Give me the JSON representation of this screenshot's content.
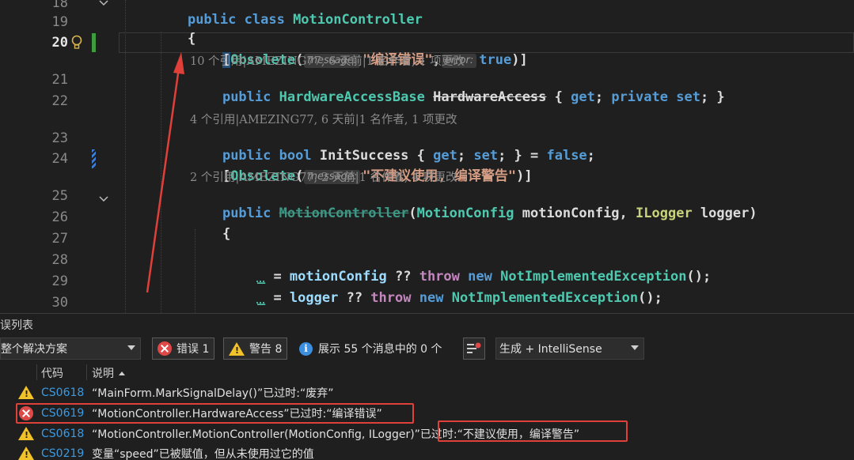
{
  "editor": {
    "line_numbers": [
      "18",
      "19",
      "20",
      "21",
      "22",
      "23",
      "24",
      "25",
      "26",
      "27",
      "28",
      "29",
      "30"
    ],
    "active_line": "20",
    "lines": {
      "l18": {
        "kw": "public",
        "kw2": "class",
        "name": "MotionController"
      },
      "l19": {
        "brace": "{"
      },
      "l20": {
        "open": "[",
        "attr": "Obsolete",
        "paren_open": "(",
        "hint_message": "message:",
        "str": "\"编译错误\"",
        "comma": ",",
        "hint_error": "error:",
        "val": "true",
        "close": ")]"
      },
      "lens1": "10 个引用|AMEZING77, 6 天前|1 名作者, 1 项更改",
      "l21": {
        "kw": "public",
        "type": "HardwareAccessBase",
        "name": "HardwareAccess",
        "rest1": " { ",
        "get": "get",
        "semi1": "; ",
        "private": "private",
        "set": "set",
        "rest2": "; }"
      },
      "lens2": "4 个引用|AMEZING77, 6 天前|1 名作者, 1 项更改",
      "l23": {
        "kw": "public",
        "kw2": "bool",
        "name": "InitSuccess",
        "rest1": " { ",
        "get": "get",
        "semi1": "; ",
        "set": "set",
        "rest2": "; } = ",
        "false": "false",
        "end": ";"
      },
      "l24": {
        "open": "[",
        "attr": "Obsolete",
        "paren_open": "(",
        "hint_message": "message:",
        "str": "\"不建议使用, 编译警告\"",
        "close": ")]"
      },
      "lens3": "2 个引用|AMEZING77, 2 天前|1 名作者, 4 项更改",
      "l25": {
        "kw": "public",
        "ctor": "MotionController",
        "p_open": "(",
        "t1": "MotionConfig",
        "a1": "motionConfig",
        "comma": ", ",
        "t2": "ILogger",
        "a2": "logger",
        "p_close": ")"
      },
      "l26": {
        "brace": "{"
      },
      "l28": {
        "discard": "_",
        "eq": " = ",
        "arg": "motionConfig",
        "op": " ?? ",
        "throw": "throw",
        "new": "new",
        "exc": "NotImplementedException",
        "end": "();"
      },
      "l29": {
        "discard": "_",
        "eq": " = ",
        "arg": "logger",
        "op": " ?? ",
        "throw": "throw",
        "new": "new",
        "exc": "NotImplementedException",
        "end": "();"
      }
    }
  },
  "error_list": {
    "title": "误列表",
    "scope": "整个解决方案",
    "errors_button": "错误 1",
    "warnings_button": "警告 8",
    "messages_button": "展示 55 个消息中的 0 个",
    "build_filter": "生成 + IntelliSense",
    "columns": {
      "code": "代码",
      "description": "说明"
    },
    "rows": [
      {
        "severity": "warning",
        "code": "CS0618",
        "description": "“MainForm.MarkSignalDelay()”已过时:“废弃”"
      },
      {
        "severity": "error",
        "code": "CS0619",
        "description": "“MotionController.HardwareAccess”已过时:“编译错误”"
      },
      {
        "severity": "warning",
        "code": "CS0618",
        "description": "“MotionController.MotionController(MotionConfig, ILogger)”已过时:“不建议使用，编译警告”"
      },
      {
        "severity": "warning",
        "code": "CS0219",
        "description": "变量“speed”已被赋值，但从未使用过它的值"
      }
    ]
  },
  "colors": {
    "background": "#1f1f1f",
    "keyword": "#569cd6",
    "type": "#4ec9b0",
    "string": "#d69d85",
    "error_red": "#e04848",
    "warning_yellow": "#f2c229",
    "annotation_red": "#e0403a"
  }
}
